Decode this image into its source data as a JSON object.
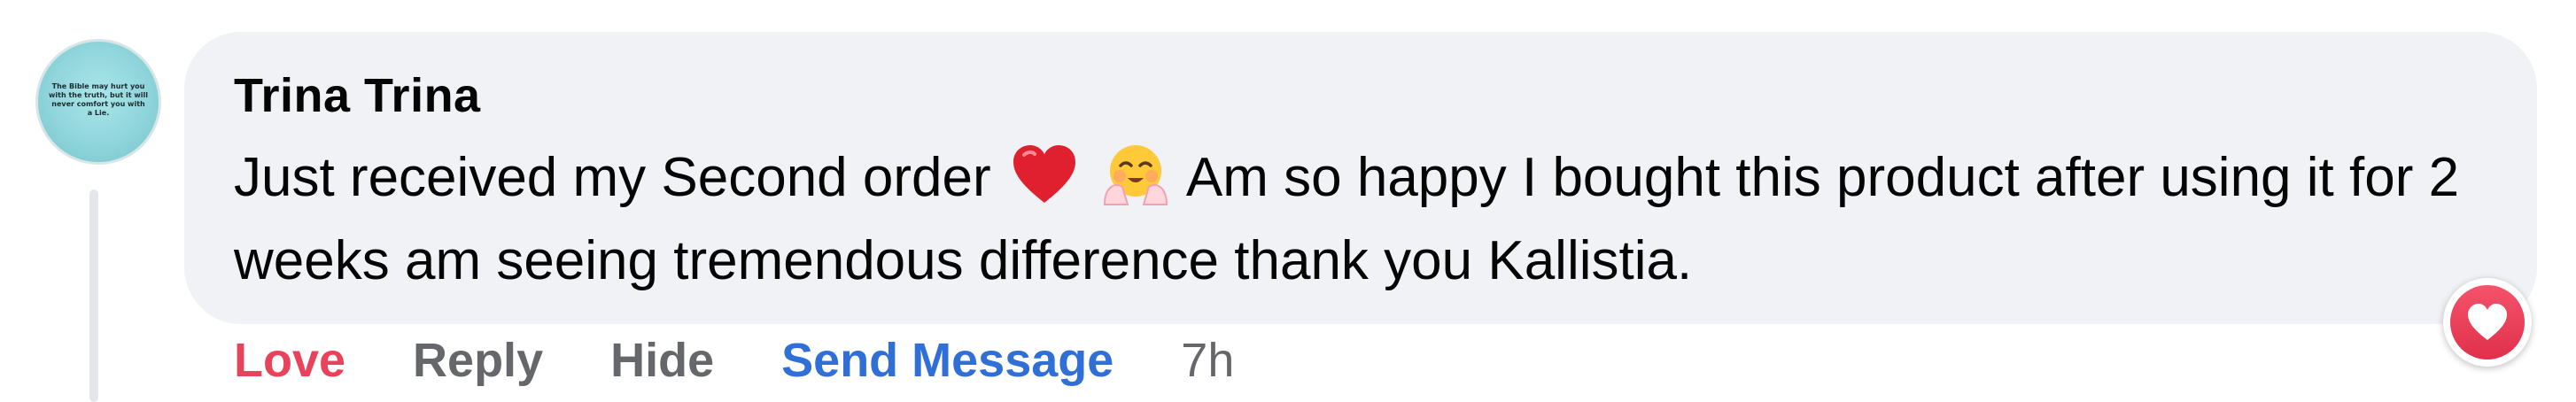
{
  "comment": {
    "avatar_text": "The Bible may hurt you with the truth, but it will never comfort you with a Lie.",
    "author": "Trina Trina",
    "text_part1": "Just received my Second order",
    "text_part2": "Am so happy I bought this product after using it for 2 weeks am seeing tremendous difference thank you Kallistia.",
    "emojis": [
      "heart-emoji",
      "smiling-face-with-open-hands-emoji"
    ]
  },
  "actions": {
    "love": "Love",
    "reply": "Reply",
    "hide": "Hide",
    "send_message": "Send Message",
    "time": "7h"
  },
  "reaction": {
    "type": "love",
    "icon": "heart-icon"
  },
  "colors": {
    "bubble_bg": "#f0f2f5",
    "love_red": "#e8435a",
    "link_blue": "#2f6fd6",
    "muted_gray": "#65676b",
    "avatar_teal": "#8fd5db"
  }
}
